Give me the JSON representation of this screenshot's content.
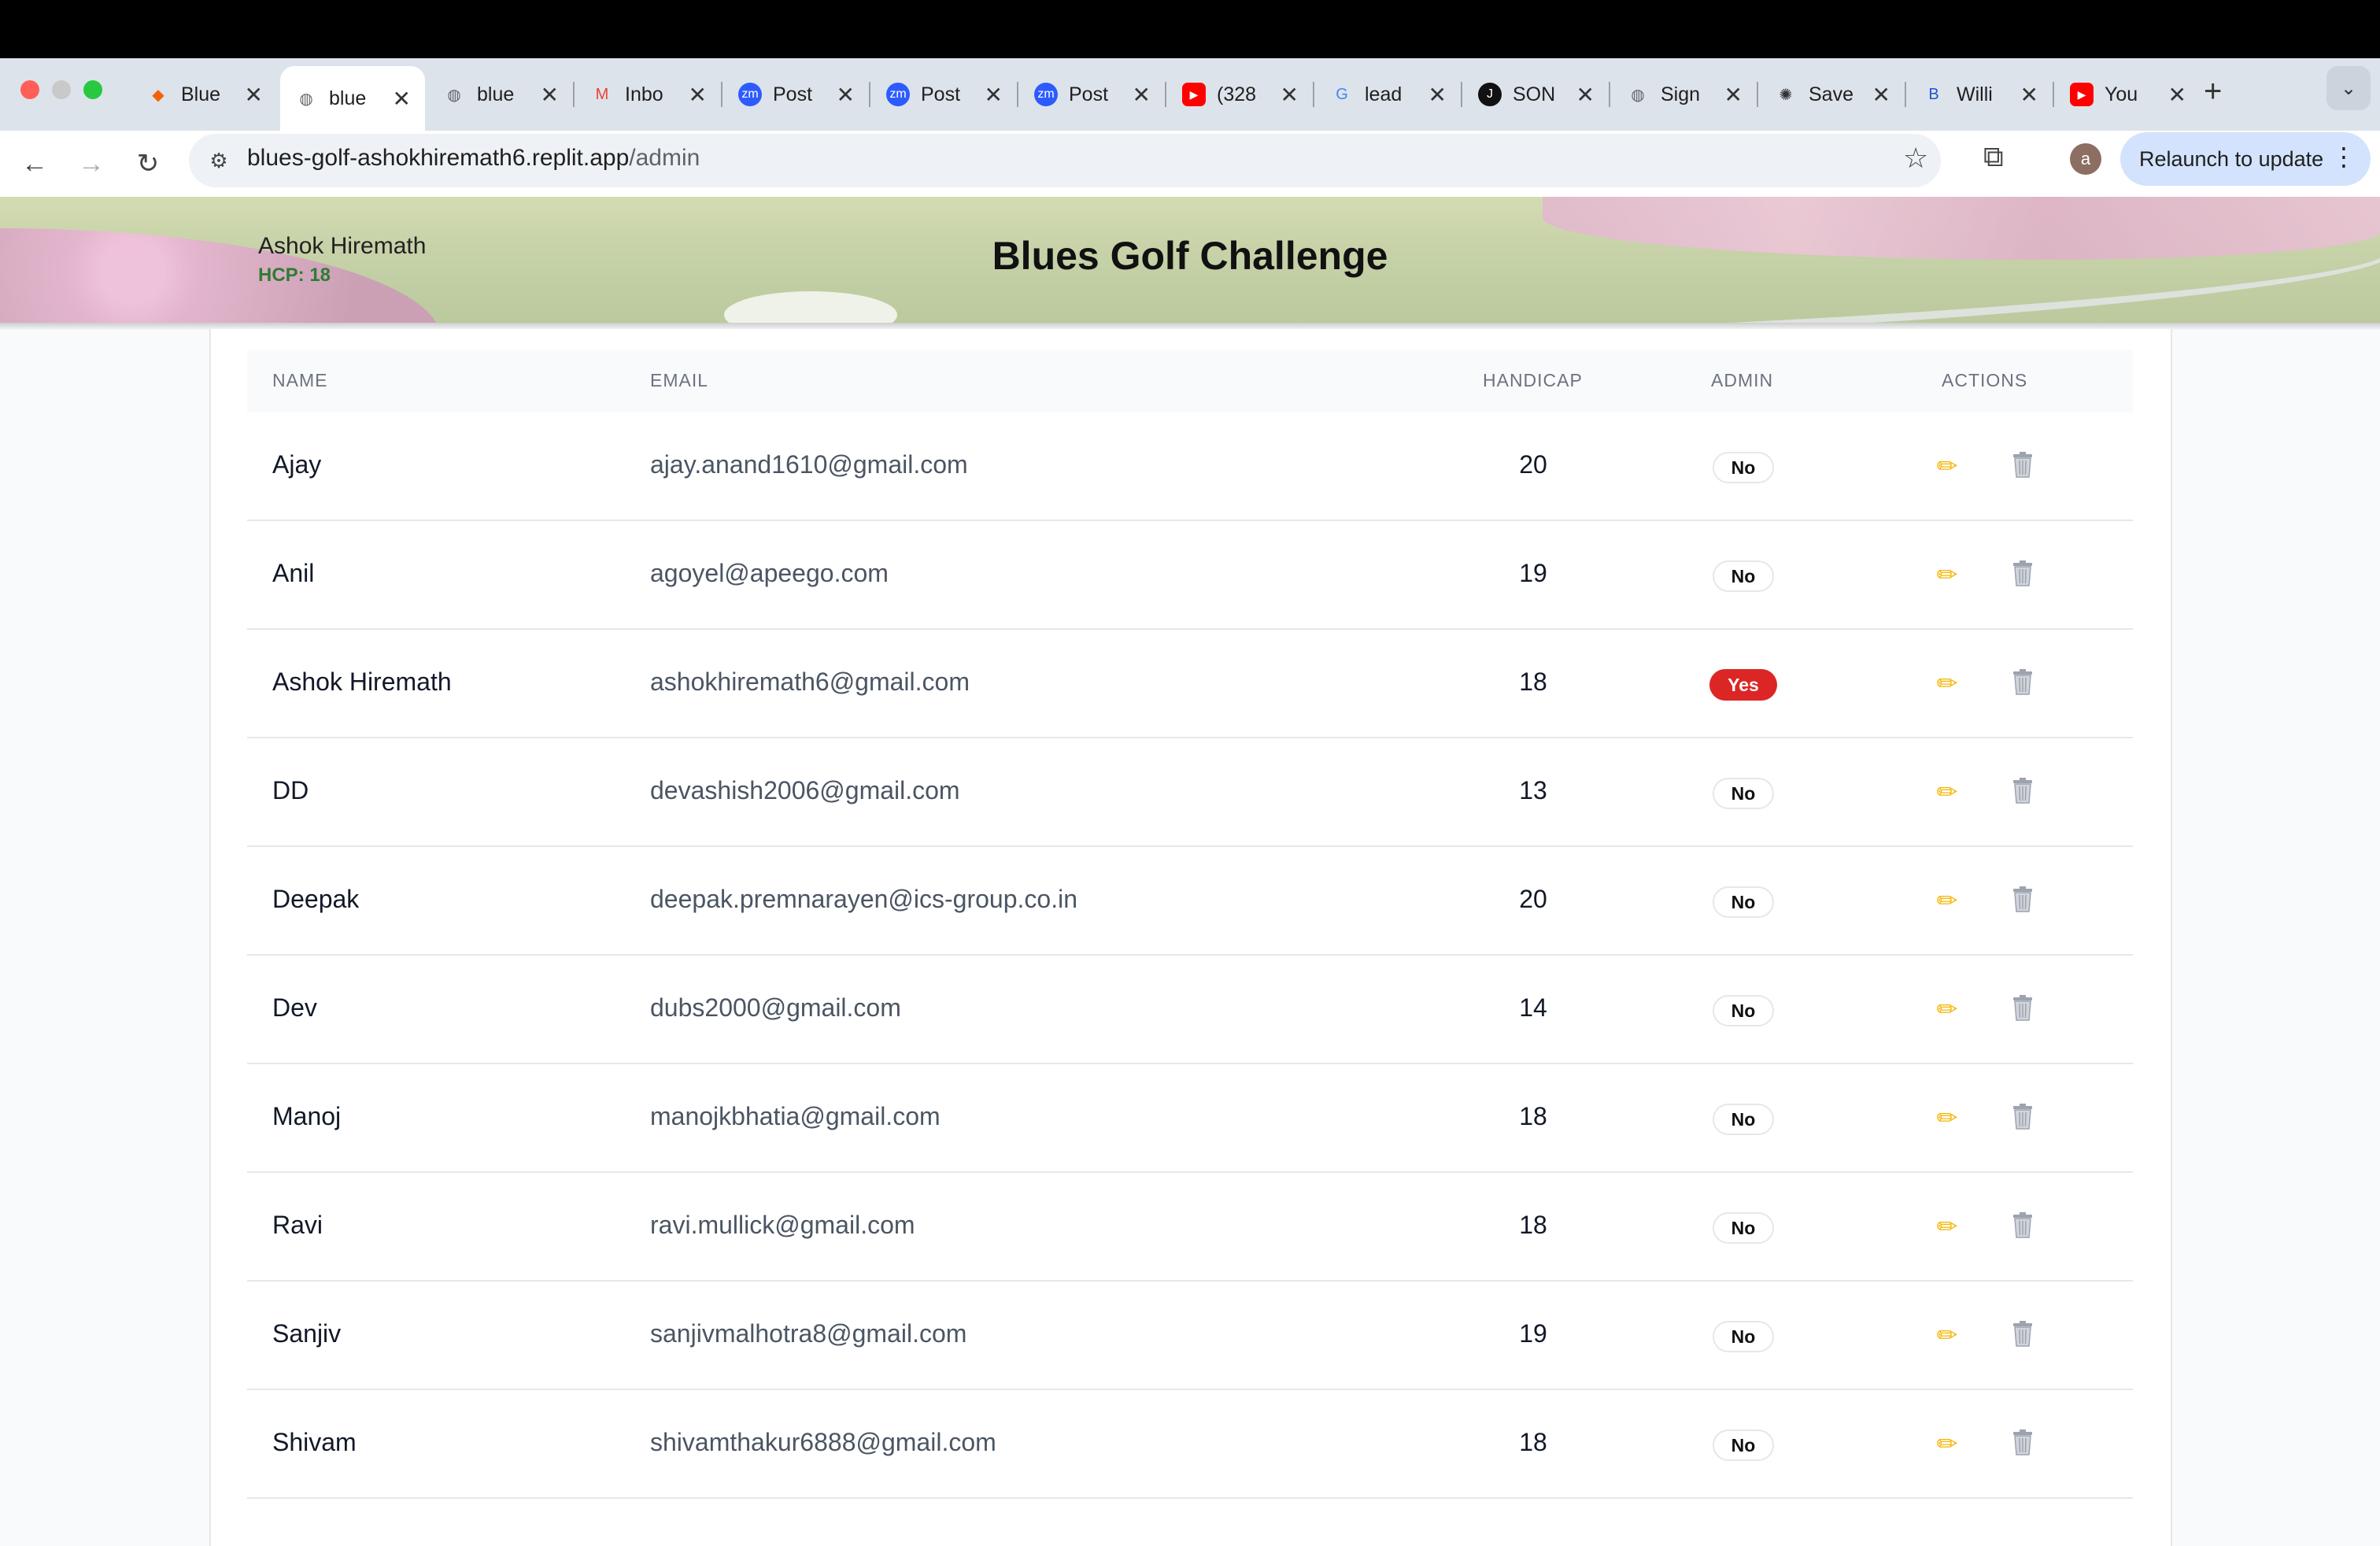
{
  "browser": {
    "tabs": [
      {
        "title": "Blue",
        "icon": "replit-icon",
        "color": "#f26207"
      },
      {
        "title": "blue",
        "icon": "globe-icon",
        "color": "#5f6368",
        "active": true
      },
      {
        "title": "blue",
        "icon": "globe-icon",
        "color": "#5f6368"
      },
      {
        "title": "Inbo",
        "icon": "gmail-icon",
        "color": "#ea4335"
      },
      {
        "title": "Post",
        "icon": "zoom-icon",
        "color": "#2d5bff"
      },
      {
        "title": "Post",
        "icon": "zoom-icon",
        "color": "#2d5bff"
      },
      {
        "title": "Post",
        "icon": "zoom-icon",
        "color": "#2d5bff"
      },
      {
        "title": "(328",
        "icon": "youtube-icon",
        "color": "#ff0000"
      },
      {
        "title": "lead",
        "icon": "google-icon",
        "color": "#4285f4"
      },
      {
        "title": "SON",
        "icon": "app-icon",
        "color": "#111111"
      },
      {
        "title": "Sign",
        "icon": "globe-icon",
        "color": "#5f6368"
      },
      {
        "title": "Save",
        "icon": "openai-icon",
        "color": "#333333"
      },
      {
        "title": "Willi",
        "icon": "b-icon",
        "color": "#2255cc"
      },
      {
        "title": "You",
        "icon": "youtube-icon",
        "color": "#ff0000"
      }
    ],
    "url_host": "blues-golf-ashokhiremath6.replit.app",
    "url_path": "/admin",
    "relaunch_label": "Relaunch to update",
    "avatar_letter": "a"
  },
  "header": {
    "user_name": "Ashok Hiremath",
    "user_hcp": "HCP: 18",
    "title": "Blues Golf Challenge"
  },
  "table": {
    "columns": {
      "name": "NAME",
      "email": "EMAIL",
      "handicap": "HANDICAP",
      "admin": "ADMIN",
      "actions": "ACTIONS"
    },
    "rows": [
      {
        "name": "Ajay",
        "email": "ajay.anand1610@gmail.com",
        "handicap": "20",
        "admin": "No"
      },
      {
        "name": "Anil",
        "email": "agoyel@apeego.com",
        "handicap": "19",
        "admin": "No"
      },
      {
        "name": "Ashok Hiremath",
        "email": "ashokhiremath6@gmail.com",
        "handicap": "18",
        "admin": "Yes"
      },
      {
        "name": "DD",
        "email": "devashish2006@gmail.com",
        "handicap": "13",
        "admin": "No"
      },
      {
        "name": "Deepak",
        "email": "deepak.premnarayen@ics-group.co.in",
        "handicap": "20",
        "admin": "No"
      },
      {
        "name": "Dev",
        "email": "dubs2000@gmail.com",
        "handicap": "14",
        "admin": "No"
      },
      {
        "name": "Manoj",
        "email": "manojkbhatia@gmail.com",
        "handicap": "18",
        "admin": "No"
      },
      {
        "name": "Ravi",
        "email": "ravi.mullick@gmail.com",
        "handicap": "18",
        "admin": "No"
      },
      {
        "name": "Sanjiv",
        "email": "sanjivmalhotra8@gmail.com",
        "handicap": "19",
        "admin": "No"
      },
      {
        "name": "Shivam",
        "email": "shivamthakur6888@gmail.com",
        "handicap": "18",
        "admin": "No"
      }
    ]
  },
  "colors": {
    "admin_yes": "#dc2626",
    "hcp_green": "#2e7d32",
    "pencil": "#f4b400"
  }
}
